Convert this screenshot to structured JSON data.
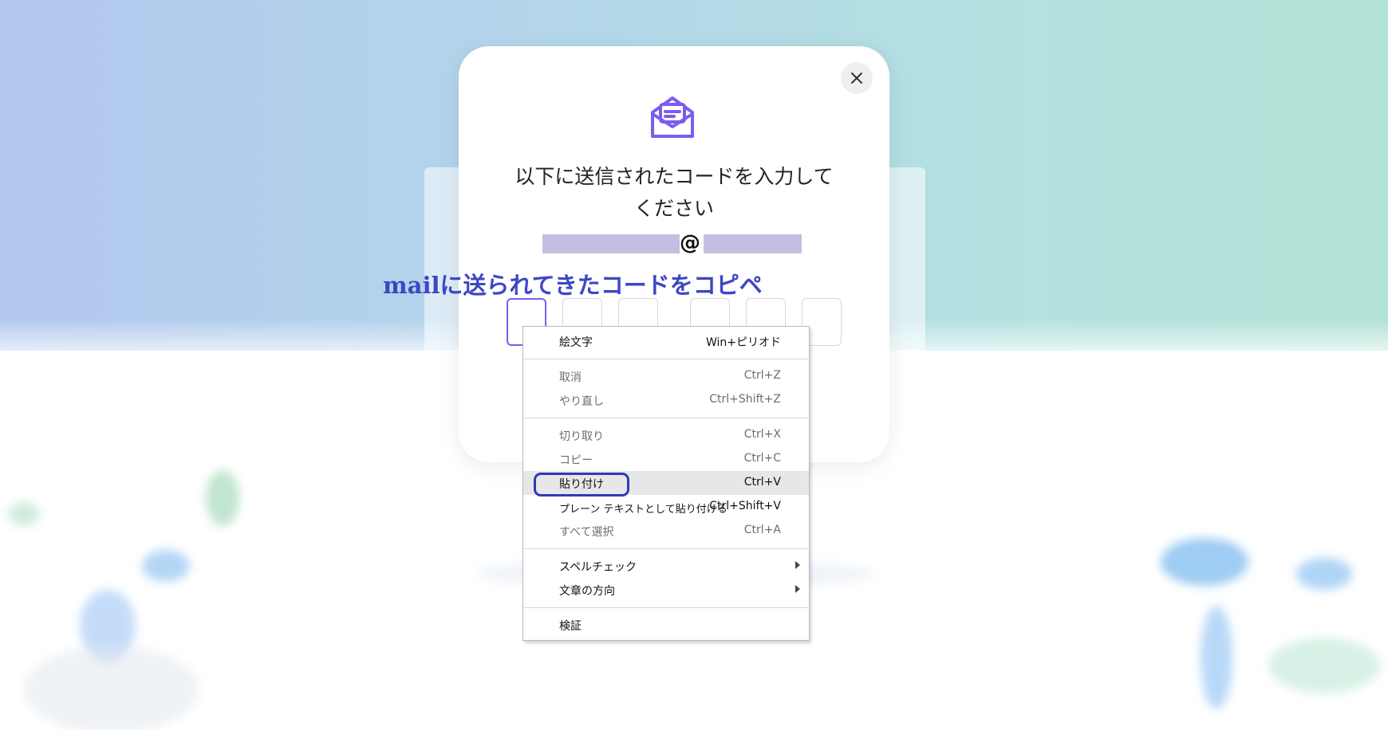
{
  "dialog": {
    "heading_line1": "以下に送信されたコードを入力して",
    "heading_line2": "ください",
    "email_at": "@",
    "close_icon": "close-icon",
    "mail_icon": "open-envelope-icon",
    "accent_color": "#7a5df0"
  },
  "annotation": {
    "text": "mailに送られてきたコードをコピペ",
    "color": "#3d47c4"
  },
  "code_inputs": {
    "count": 6,
    "values": [
      "",
      "",
      "",
      "",
      "",
      ""
    ]
  },
  "context_menu": {
    "items": [
      {
        "label": "絵文字",
        "shortcut": "Win+ピリオド",
        "state": "enabled"
      },
      {
        "label": "取消",
        "shortcut": "Ctrl+Z",
        "state": "disabled"
      },
      {
        "label": "やり直し",
        "shortcut": "Ctrl+Shift+Z",
        "state": "disabled"
      },
      {
        "label": "切り取り",
        "shortcut": "Ctrl+X",
        "state": "disabled"
      },
      {
        "label": "コピー",
        "shortcut": "Ctrl+C",
        "state": "disabled"
      },
      {
        "label": "貼り付け",
        "shortcut": "Ctrl+V",
        "state": "highlighted"
      },
      {
        "label": "プレーン テキストとして貼り付ける",
        "shortcut": "Ctrl+Shift+V",
        "state": "enabled"
      },
      {
        "label": "すべて選択",
        "shortcut": "Ctrl+A",
        "state": "disabled"
      },
      {
        "label": "スペルチェック",
        "shortcut": "",
        "state": "enabled",
        "submenu": true
      },
      {
        "label": "文章の方向",
        "shortcut": "",
        "state": "enabled",
        "submenu": true
      },
      {
        "label": "検証",
        "shortcut": "",
        "state": "enabled"
      }
    ]
  }
}
